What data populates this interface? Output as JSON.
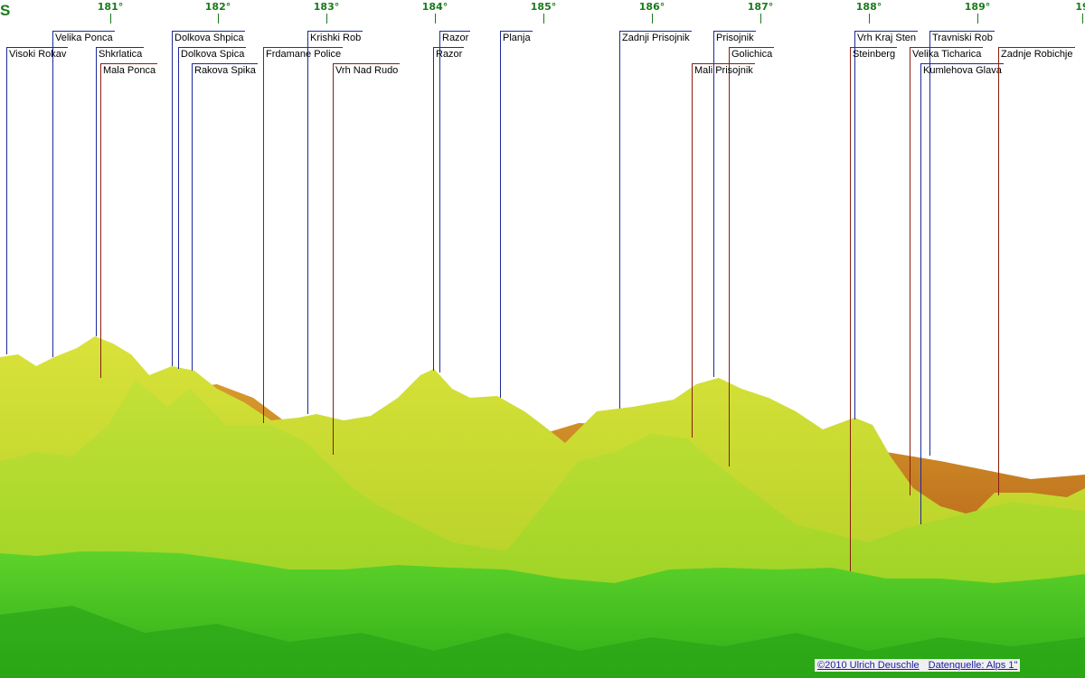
{
  "scale": {
    "left_edge_label": "S",
    "ticks": [
      "181°",
      "182°",
      "183°",
      "184°",
      "185°",
      "186°",
      "187°",
      "188°",
      "189°",
      "19"
    ]
  },
  "peaks": [
    {
      "name": "Visoki Rokav",
      "kind": "blue"
    },
    {
      "name": "Velika Ponca",
      "kind": "blue"
    },
    {
      "name": "Shkrlatica",
      "kind": "blue"
    },
    {
      "name": "Mala Ponca",
      "kind": "red"
    },
    {
      "name": "Dolkova Shpica",
      "kind": "blue"
    },
    {
      "name": "Dolkova Spica",
      "kind": "blue"
    },
    {
      "name": "Rakova Spika",
      "kind": "blue"
    },
    {
      "name": "Frdamane Police",
      "kind": "red"
    },
    {
      "name": "Krishki Rob",
      "kind": "blue"
    },
    {
      "name": "Vrh Nad Rudo",
      "kind": "red"
    },
    {
      "name": "Razor",
      "kind": "blue"
    },
    {
      "name": "Razor",
      "kind": "blue"
    },
    {
      "name": "Planja",
      "kind": "blue"
    },
    {
      "name": "Zadnji Prisojnik",
      "kind": "blue"
    },
    {
      "name": "Prisojnik",
      "kind": "blue"
    },
    {
      "name": "Golichica",
      "kind": "red"
    },
    {
      "name": "Mali Prisojnik",
      "kind": "red"
    },
    {
      "name": "Vrh Kraj Sten",
      "kind": "blue"
    },
    {
      "name": "Steinberg",
      "kind": "red"
    },
    {
      "name": "Travniski Rob",
      "kind": "blue"
    },
    {
      "name": "Velika Ticharica",
      "kind": "red"
    },
    {
      "name": "Kumlehova Glava",
      "kind": "blue"
    },
    {
      "name": "Zadnje Robichje",
      "kind": "red"
    }
  ],
  "credits": {
    "copyright": "©2010 Ulrich Deuschle",
    "source": "Datenquelle: Alps 1\""
  },
  "colors": {
    "scale": "#1a7a1a",
    "blue_line": "#1c2a9a",
    "red_line": "#8a1e12",
    "far_orange": "#d8862a",
    "mid_yellow": "#c8dc2a",
    "near_green": "#3fbf1e"
  }
}
